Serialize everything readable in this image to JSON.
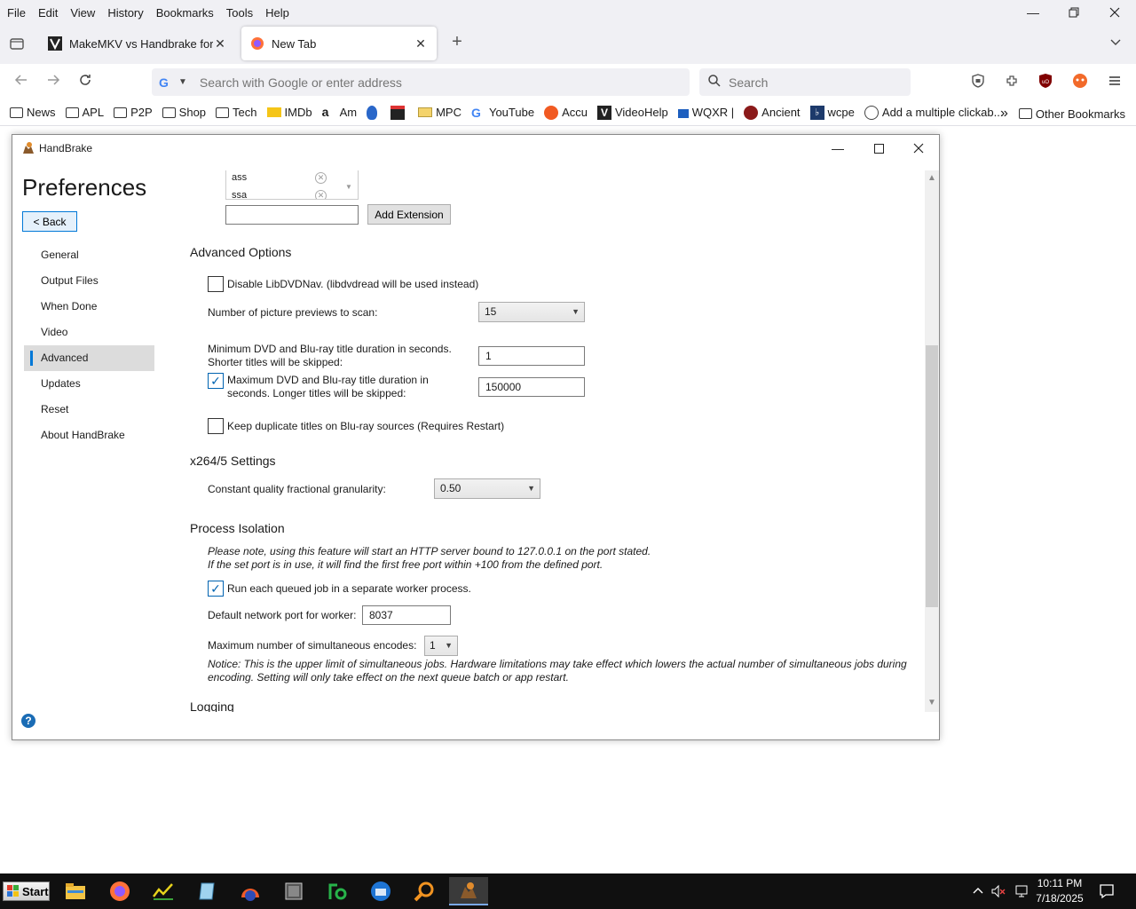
{
  "firefox": {
    "menu": [
      "File",
      "Edit",
      "View",
      "History",
      "Bookmarks",
      "Tools",
      "Help"
    ],
    "tabs": [
      {
        "title": "MakeMKV vs Handbrake for DVD",
        "active": false
      },
      {
        "title": "New Tab",
        "active": true
      }
    ],
    "url_placeholder": "Search with Google or enter address",
    "search_placeholder": "Search",
    "bookmarks": [
      {
        "label": "News",
        "icon": "folder-icon"
      },
      {
        "label": "APL",
        "icon": "folder-icon"
      },
      {
        "label": "P2P",
        "icon": "folder-icon"
      },
      {
        "label": "Shop",
        "icon": "folder-icon"
      },
      {
        "label": "Tech",
        "icon": "folder-icon"
      },
      {
        "label": "IMDb",
        "icon": "imdb-icon"
      },
      {
        "label": "Am",
        "icon": "amazon-icon"
      },
      {
        "label": "",
        "icon": "shield-bookmark-icon"
      },
      {
        "label": "",
        "icon": "shopping-bag-icon"
      },
      {
        "label": "MPC",
        "icon": "mail-icon"
      },
      {
        "label": "YouTube",
        "icon": "google-icon"
      },
      {
        "label": "Accu",
        "icon": "sun-icon"
      },
      {
        "label": "VideoHelp",
        "icon": "videohelp-icon"
      },
      {
        "label": "WQXR |",
        "icon": "bars-icon"
      },
      {
        "label": "Ancient",
        "icon": "ancient-icon"
      },
      {
        "label": "wcpe",
        "icon": "music-icon"
      },
      {
        "label": "Add a multiple clickab...",
        "icon": "globe-icon"
      }
    ],
    "other_bookmarks": "Other Bookmarks"
  },
  "handbrake": {
    "window_title": "HandBrake",
    "page_title": "Preferences",
    "back_label": "< Back",
    "nav": [
      "General",
      "Output Files",
      "When Done",
      "Video",
      "Advanced",
      "Updates",
      "Reset",
      "About HandBrake"
    ],
    "selected_nav": "Advanced",
    "extensions": [
      "ass",
      "ssa"
    ],
    "add_extension_label": "Add Extension",
    "advanced_options": {
      "heading": "Advanced Options",
      "disable_libdvdnav": "Disable LibDVDNav. (libdvdread will be used instead)",
      "previews_label": "Number of picture previews to scan:",
      "previews_value": "15",
      "min_duration_label_1": "Minimum DVD and Blu-ray title duration in seconds.",
      "min_duration_label_2": "Shorter titles will be skipped:",
      "min_duration_value": "1",
      "max_duration_label_1": "Maximum DVD and Blu-ray title duration in",
      "max_duration_label_2": "seconds. Longer titles will be skipped:",
      "max_duration_value": "150000",
      "max_duration_checked": true,
      "keep_duplicates": "Keep duplicate titles on Blu-ray sources (Requires Restart)"
    },
    "x264": {
      "heading": "x264/5 Settings",
      "granularity_label": "Constant quality fractional granularity:",
      "granularity_value": "0.50"
    },
    "process_isolation": {
      "heading": "Process Isolation",
      "note_1": "Please note, using this feature will start an HTTP server bound to 127.0.0.1 on the port stated.",
      "note_2": "If the set port is in use, it will find the first free port within +100 from the defined port.",
      "worker_label": "Run each queued job in a separate worker process.",
      "worker_checked": true,
      "port_label": "Default network port for worker:",
      "port_value": "8037",
      "max_encodes_label": "Maximum number of simultaneous encodes:",
      "max_encodes_value": "1",
      "notice_1": "Notice: This is the upper limit of simultaneous jobs. Hardware limitations may take effect which lowers the actual number of simultaneous jobs during",
      "notice_2": "encoding. Setting will only take effect on the next queue batch or app restart."
    },
    "logging_heading": "Logging"
  },
  "taskbar": {
    "start_label": "Start",
    "time": "10:11 PM",
    "date": "7/18/2025"
  },
  "colors": {
    "accent": "#0078d7",
    "firefox_chrome": "#f0f0f4",
    "taskbar": "#101010"
  }
}
